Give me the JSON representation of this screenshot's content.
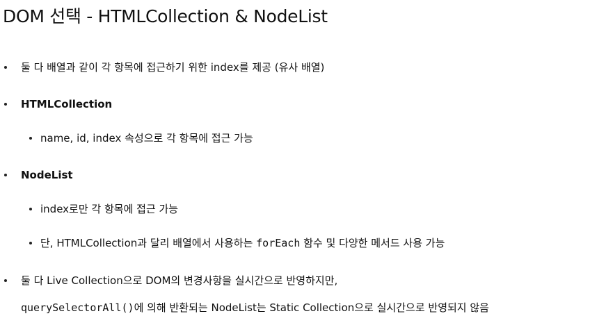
{
  "title": "DOM 선택 - HTMLCollection & NodeList",
  "items": [
    {
      "text": "둘 다 배열과 같이 각 항목에 접근하기 위한 index를 제공 (유사 배열)"
    },
    {
      "text": "HTMLCollection"
    },
    {
      "text": "name, id, index 속성으로 각 항목에 접근 가능"
    },
    {
      "text": "NodeList"
    },
    {
      "text": "index로만 각 항목에 접근 가능"
    },
    {
      "pre": "단, HTMLCollection과 달리 배열에서 사용하는 ",
      "code": "forEach",
      "post": " 함수 및 다양한 메서드 사용 가능"
    },
    {
      "text": "둘 다 Live Collection으로 DOM의 변경사항을 실시간으로 반영하지만,"
    },
    {
      "code": "querySelectorAll()",
      "post": "에 의해 반환되는 NodeList는 Static Collection으로 실시간으로 반영되지 않음"
    }
  ]
}
